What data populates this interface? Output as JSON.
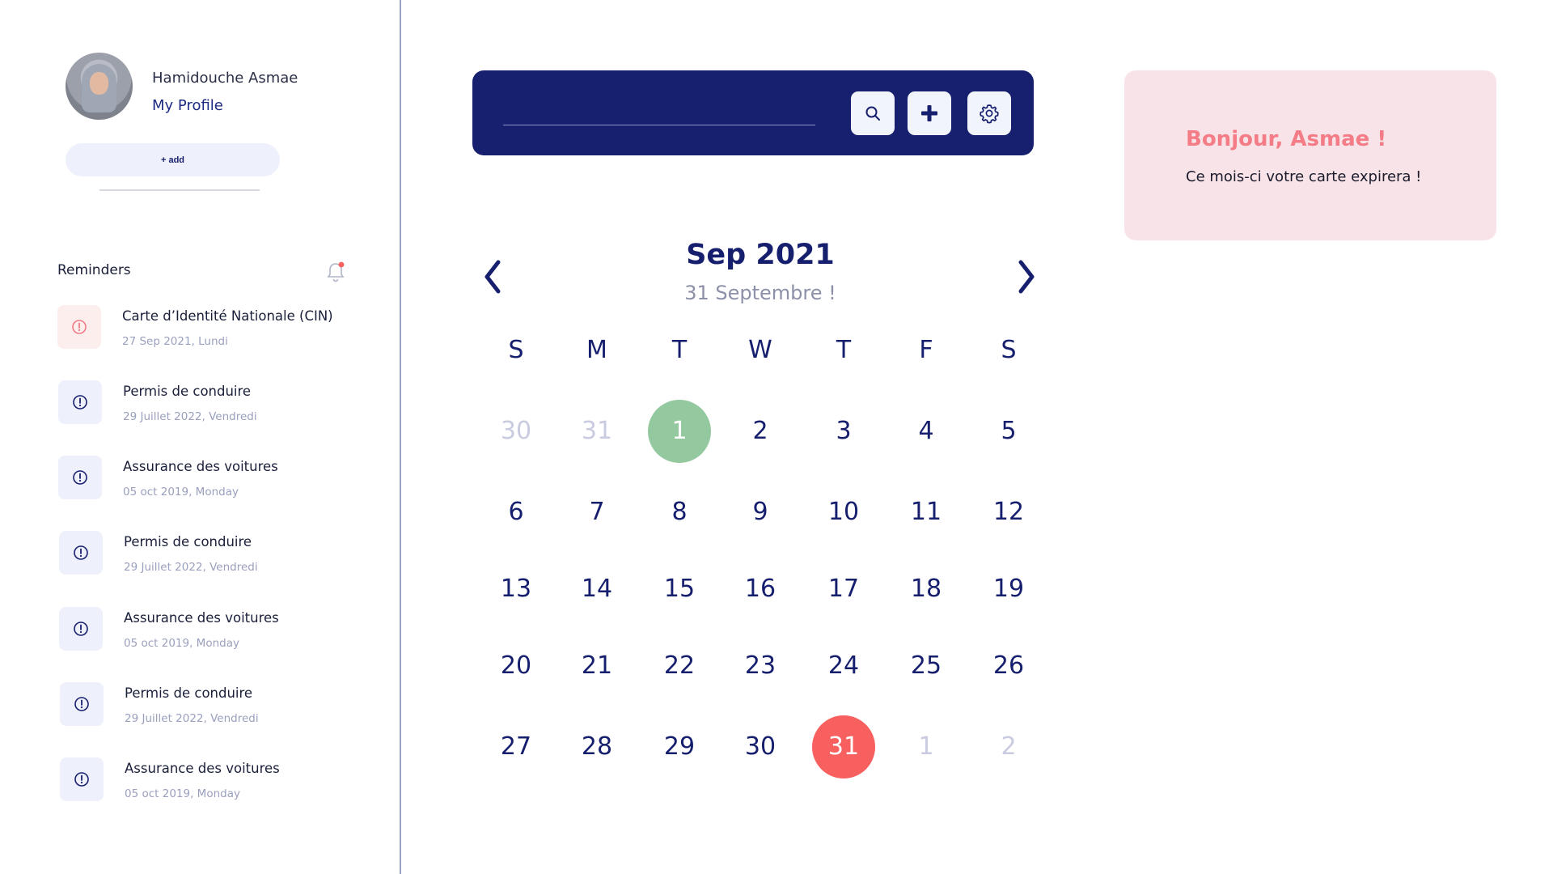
{
  "profile": {
    "name": "Hamidouche Asmae",
    "link": "My Profile",
    "add_label": "+ add"
  },
  "reminders": {
    "title": "Reminders",
    "items": [
      {
        "name": "Carte d’Identité Nationale (CIN)",
        "date": "27 Sep 2021, Lundi",
        "status": "alert"
      },
      {
        "name": "Permis de conduire",
        "date": "29 Juillet 2022, Vendredi",
        "status": "info"
      },
      {
        "name": "Assurance des voitures",
        "date": "05 oct 2019, Monday",
        "status": "info"
      },
      {
        "name": "Permis de conduire",
        "date": "29 Juillet 2022, Vendredi",
        "status": "info"
      },
      {
        "name": "Assurance des voitures",
        "date": "05 oct 2019, Monday",
        "status": "info"
      },
      {
        "name": "Permis de conduire",
        "date": "29 Juillet 2022, Vendredi",
        "status": "info"
      },
      {
        "name": "Assurance des voitures",
        "date": "05 oct 2019, Monday",
        "status": "info"
      }
    ]
  },
  "search": {
    "value": "",
    "placeholder": ""
  },
  "toolbar": {
    "icons": [
      "search-icon",
      "plus-icon",
      "gear-icon"
    ]
  },
  "calendar": {
    "title": "Sep 2021",
    "subtitle": "31 Septembre !",
    "weekdays": [
      "S",
      "M",
      "T",
      "W",
      "T",
      "F",
      "S"
    ],
    "days": [
      {
        "d": "30",
        "muted": true
      },
      {
        "d": "31",
        "muted": true
      },
      {
        "d": "1",
        "mark": "green"
      },
      {
        "d": "2"
      },
      {
        "d": "3"
      },
      {
        "d": "4"
      },
      {
        "d": "5"
      },
      {
        "d": "6"
      },
      {
        "d": "7"
      },
      {
        "d": "8"
      },
      {
        "d": "9"
      },
      {
        "d": "10"
      },
      {
        "d": "11"
      },
      {
        "d": "12"
      },
      {
        "d": "13"
      },
      {
        "d": "14"
      },
      {
        "d": "15"
      },
      {
        "d": "16"
      },
      {
        "d": "17"
      },
      {
        "d": "18"
      },
      {
        "d": "19"
      },
      {
        "d": "20"
      },
      {
        "d": "21"
      },
      {
        "d": "22"
      },
      {
        "d": "23"
      },
      {
        "d": "24"
      },
      {
        "d": "25"
      },
      {
        "d": "26"
      },
      {
        "d": "27"
      },
      {
        "d": "28"
      },
      {
        "d": "29"
      },
      {
        "d": "30"
      },
      {
        "d": "31",
        "mark": "red"
      },
      {
        "d": "1",
        "muted": true
      },
      {
        "d": "2",
        "muted": true
      }
    ]
  },
  "greeting": {
    "title": "Bonjour,  Asmae !",
    "message": "Ce mois-ci votre carte expirera !"
  },
  "colors": {
    "navy": "#171f6f",
    "accent_red": "#f8605f",
    "accent_green": "#94c89e",
    "pink_card": "#f8e4e8",
    "greeting_text": "#f47c86"
  }
}
